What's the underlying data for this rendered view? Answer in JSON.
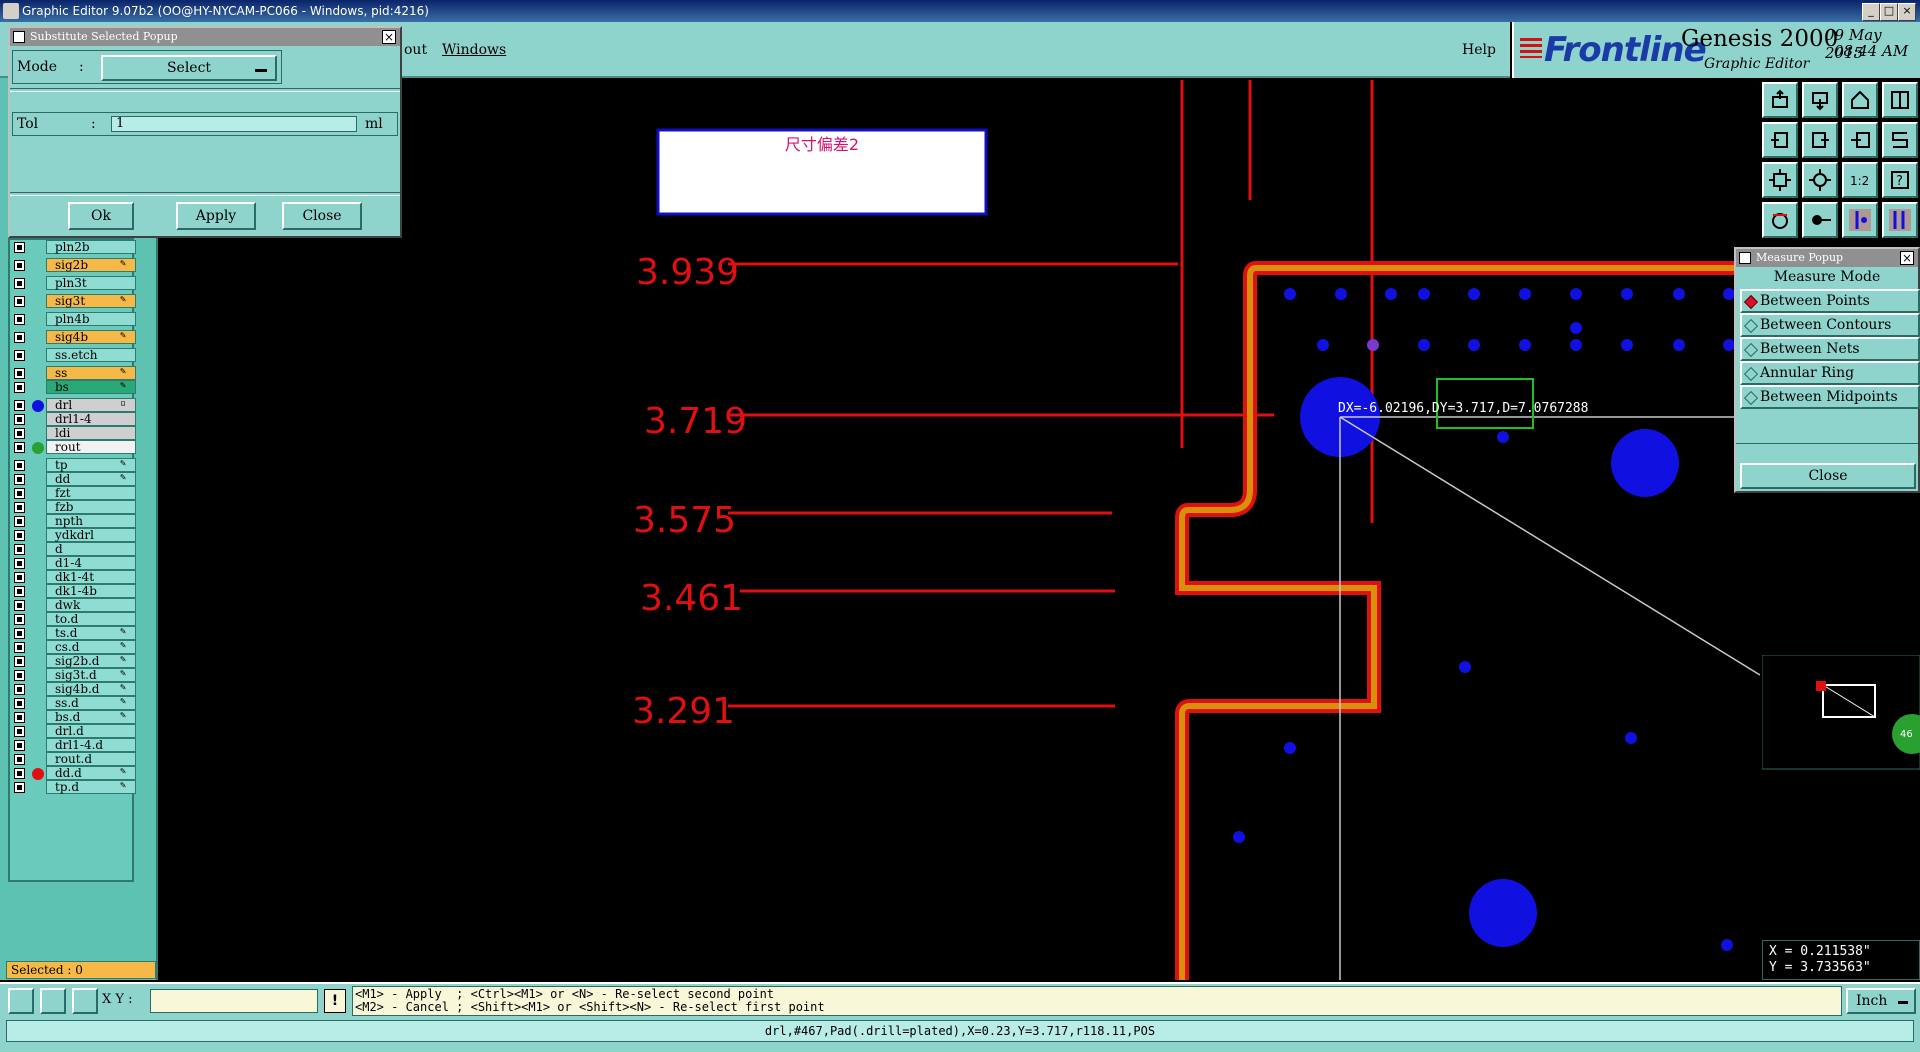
{
  "window": {
    "title": "Graphic Editor 9.07b2 (OO@HY-NYCAM-PC066 - Windows, pid:4216)",
    "min": "_",
    "max": "□",
    "close": "×"
  },
  "menubar": {
    "items": [
      "out",
      "Windows"
    ],
    "help": "Help"
  },
  "logo": {
    "brand": "Frontline",
    "product": "Genesis 2000",
    "subtitle": "Graphic Editor",
    "date": "09 May 2015",
    "time": "08:44 AM"
  },
  "substitute_popup": {
    "title": "Substitute Selected Popup",
    "close": "×",
    "mode_label": "Mode",
    "colon": ":",
    "mode_value": "Select",
    "tol_label": "Tol",
    "tol_value": "1",
    "tol_unit": "ml",
    "ok": "Ok",
    "apply": "Apply",
    "close_btn": "Close"
  },
  "layers": [
    {
      "name": "pln2b",
      "style": "plain",
      "mark": ""
    },
    {
      "name": "sig2b",
      "style": "sig",
      "mark": "✎"
    },
    {
      "name": "pln3t",
      "style": "plain",
      "mark": ""
    },
    {
      "name": "sig3t",
      "style": "sig",
      "mark": "✎"
    },
    {
      "name": "pln4b",
      "style": "plain",
      "mark": ""
    },
    {
      "name": "sig4b",
      "style": "sig",
      "mark": "✎"
    },
    {
      "name": "ss.etch",
      "style": "plain",
      "mark": ""
    },
    {
      "name": "ss",
      "style": "sig",
      "mark": "✎"
    },
    {
      "name": "bs",
      "style": "green",
      "mark": "✎"
    },
    {
      "name": "drl",
      "style": "grey",
      "mark": "▫",
      "dot": "#1010e0"
    },
    {
      "name": "drl1-4",
      "style": "grey",
      "mark": ""
    },
    {
      "name": "ldi",
      "style": "grey",
      "mark": ""
    },
    {
      "name": "rout",
      "style": "white",
      "mark": "",
      "dot": "#2aa030"
    },
    {
      "name": "tp",
      "style": "plain",
      "mark": "✎"
    },
    {
      "name": "dd",
      "style": "plain",
      "mark": "✎"
    },
    {
      "name": "fzt",
      "style": "plain",
      "mark": ""
    },
    {
      "name": "fzb",
      "style": "plain",
      "mark": ""
    },
    {
      "name": "npth",
      "style": "plain",
      "mark": ""
    },
    {
      "name": "ydkdrl",
      "style": "plain",
      "mark": ""
    },
    {
      "name": "d",
      "style": "plain",
      "mark": ""
    },
    {
      "name": "d1-4",
      "style": "plain",
      "mark": ""
    },
    {
      "name": "dk1-4t",
      "style": "plain",
      "mark": ""
    },
    {
      "name": "dk1-4b",
      "style": "plain",
      "mark": ""
    },
    {
      "name": "dwk",
      "style": "plain",
      "mark": ""
    },
    {
      "name": "to.d",
      "style": "plain",
      "mark": ""
    },
    {
      "name": "ts.d",
      "style": "plain",
      "mark": "✎"
    },
    {
      "name": "cs.d",
      "style": "plain",
      "mark": "✎"
    },
    {
      "name": "sig2b.d",
      "style": "plain",
      "mark": "✎"
    },
    {
      "name": "sig3t.d",
      "style": "plain",
      "mark": "✎"
    },
    {
      "name": "sig4b.d",
      "style": "plain",
      "mark": "✎"
    },
    {
      "name": "ss.d",
      "style": "plain",
      "mark": "✎"
    },
    {
      "name": "bs.d",
      "style": "plain",
      "mark": "✎"
    },
    {
      "name": "drl.d",
      "style": "plain",
      "mark": ""
    },
    {
      "name": "drl1-4.d",
      "style": "plain",
      "mark": ""
    },
    {
      "name": "rout.d",
      "style": "plain",
      "mark": ""
    },
    {
      "name": "dd.d",
      "style": "plain",
      "mark": "✎",
      "dot": "#e01010"
    },
    {
      "name": "tp.d",
      "style": "plain",
      "mark": "✎"
    }
  ],
  "selected": "Selected : 0",
  "canvas": {
    "note_text": "尺寸偏差2",
    "dims": [
      "3.939",
      "3.719",
      "3.575",
      "3.461",
      "3.291"
    ],
    "measure_readout": "DX=-6.02196,DY=3.717,D=7.0767288",
    "badge_partial": "46"
  },
  "measure_popup": {
    "title": "Measure Popup",
    "close": "×",
    "header": "Measure Mode",
    "modes": [
      "Between Points",
      "Between Contours",
      "Between Nets",
      "Annular Ring",
      "Between Midpoints"
    ],
    "active_index": 0,
    "close_btn": "Close"
  },
  "coords": {
    "x": "X = 0.211538\"",
    "y": "Y = 3.733563\""
  },
  "bottom": {
    "xy_label": "X Y :",
    "xy_value": "",
    "exclaim": "!",
    "hint1": "<M1> - Apply  ; <Ctrl><M1> or <N> - Re-select second point",
    "hint2": "<M2> - Cancel ; <Shift><M1> or <Shift><N> - Re-select first point",
    "unit": "Inch"
  },
  "status": "drl,#467,Pad(.drill=plated),X=0.23,Y=3.717,r118.11,POS",
  "colors": {
    "teal": "#8fd4cc",
    "dim_red": "#e01010",
    "trace_orange": "#d8900a",
    "pad_blue": "#1010e0"
  }
}
